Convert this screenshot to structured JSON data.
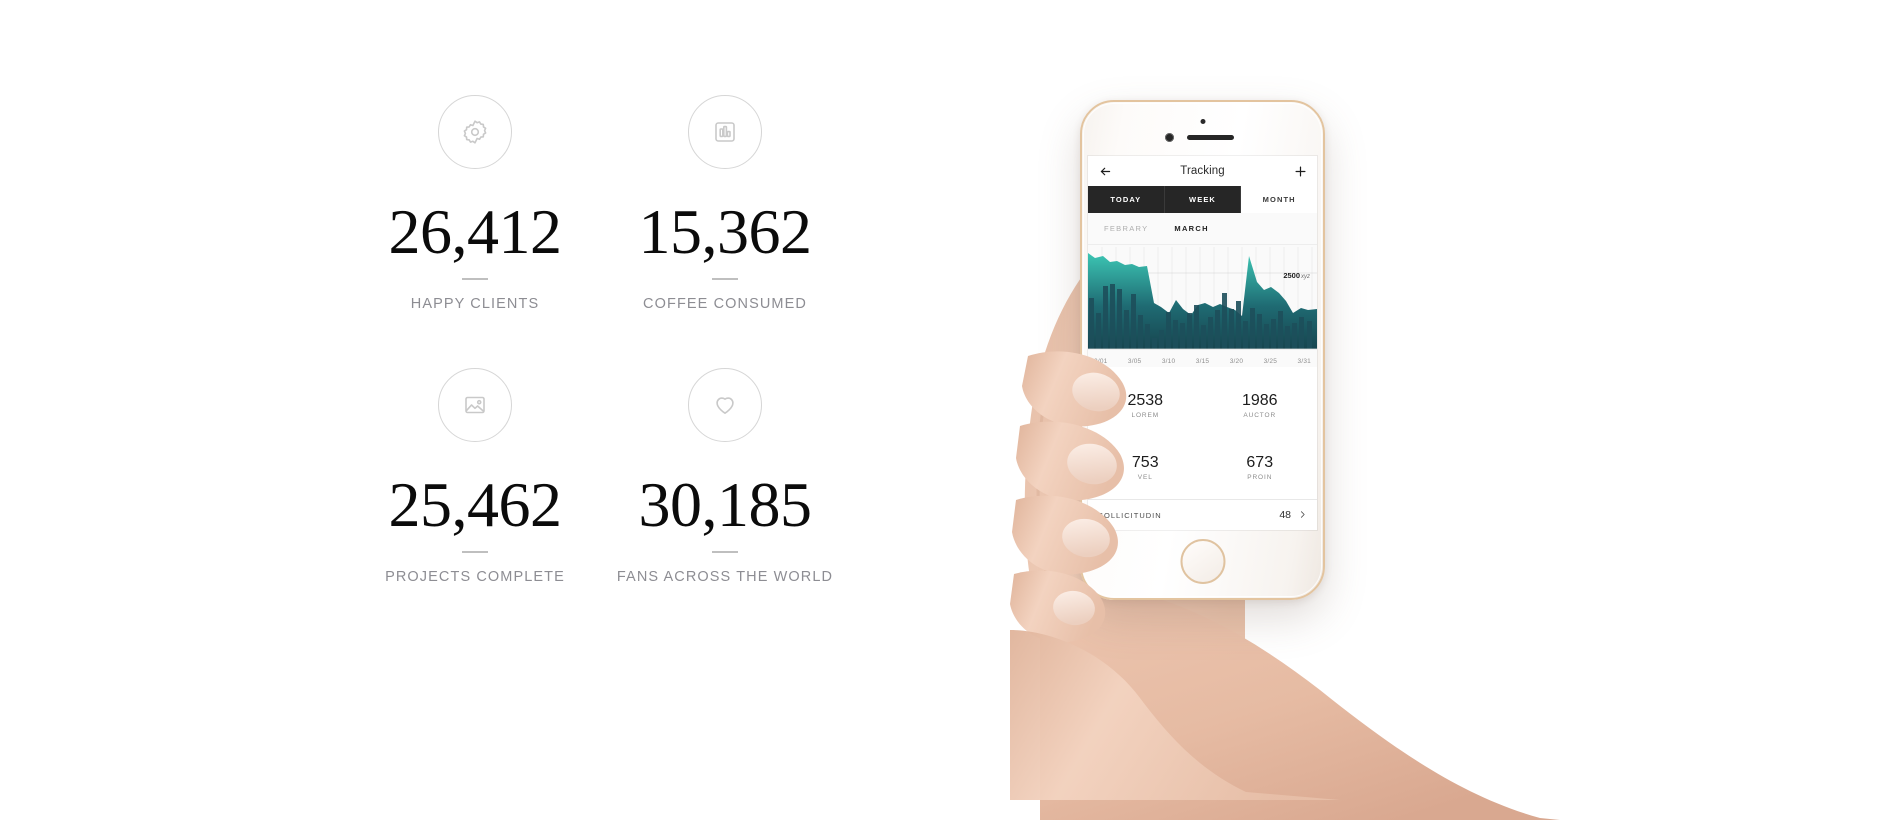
{
  "stats": [
    {
      "icon": "gear-icon",
      "value": "26,412",
      "label": "HAPPY CLIENTS"
    },
    {
      "icon": "chart-icon",
      "value": "15,362",
      "label": "COFFEE CONSUMED"
    },
    {
      "icon": "image-icon",
      "value": "25,462",
      "label": "PROJECTS COMPLETE"
    },
    {
      "icon": "heart-icon",
      "value": "30,185",
      "label": "FANS ACROSS THE WORLD"
    }
  ],
  "phone": {
    "app_bar": {
      "back_icon": "arrow-left-icon",
      "title": "Tracking",
      "add_icon": "plus-icon"
    },
    "tabs": [
      {
        "label": "TODAY",
        "active": false
      },
      {
        "label": "WEEK",
        "active": false
      },
      {
        "label": "MONTH",
        "active": true
      }
    ],
    "months": [
      {
        "label": "FEBRARY",
        "active": false
      },
      {
        "label": "MARCH",
        "active": true
      }
    ],
    "chart_annotation": {
      "value": "2500",
      "unit": "xyz"
    },
    "kpis": [
      {
        "value": "2538",
        "label": "LOREM"
      },
      {
        "value": "1986",
        "label": "AUCTOR"
      },
      {
        "value": "753",
        "label": "VEL"
      },
      {
        "value": "673",
        "label": "PROIN"
      }
    ],
    "list_row": {
      "label": "SOLLICITUDIN",
      "value": "48",
      "chevron_icon": "chevron-right-icon"
    }
  },
  "colors": {
    "chart_teal_top": "#3cc6b4",
    "chart_teal_bottom": "#17454f",
    "bar_dark": "#1d4f5b",
    "tab_dark": "#262626",
    "label_gray": "#8d8d93",
    "phone_gold": "#e3c49f"
  },
  "chart_data": {
    "type": "area",
    "title": "",
    "xlabel": "",
    "ylabel": "",
    "ylim": [
      0,
      3400
    ],
    "grid": true,
    "legend": "none",
    "annotations": [
      {
        "text": "2500 xyz",
        "y": 2500
      }
    ],
    "tick_labels": [
      "3/01",
      "3/05",
      "3/10",
      "3/15",
      "3/20",
      "3/25",
      "3/31"
    ],
    "x": [
      "3/01",
      "3/02",
      "3/03",
      "3/04",
      "3/05",
      "3/06",
      "3/07",
      "3/08",
      "3/09",
      "3/10",
      "3/11",
      "3/12",
      "3/13",
      "3/14",
      "3/15",
      "3/16",
      "3/17",
      "3/18",
      "3/19",
      "3/20",
      "3/21",
      "3/22",
      "3/23",
      "3/24",
      "3/25",
      "3/26",
      "3/27",
      "3/28",
      "3/29",
      "3/30",
      "3/31"
    ],
    "series": [
      {
        "name": "area",
        "type": "area",
        "values": [
          3280,
          3150,
          3190,
          3050,
          3080,
          2980,
          3010,
          2940,
          2960,
          1820,
          1700,
          1560,
          1900,
          1660,
          1520,
          1760,
          1820,
          1700,
          1790,
          1720,
          1640,
          1480,
          3200,
          2480,
          2260,
          2340,
          2180,
          1980,
          1560,
          1680,
          1620
        ]
      },
      {
        "name": "bars",
        "type": "bar",
        "values": [
          1980,
          1460,
          2360,
          2420,
          2280,
          1600,
          2100,
          1420,
          1140,
          620,
          900,
          1500,
          1260,
          1180,
          1460,
          1700,
          1120,
          1380,
          1580,
          2120,
          1620,
          1840,
          1240,
          1660,
          1480,
          1220,
          1360,
          1560,
          1180,
          1240,
          1400
        ]
      }
    ]
  }
}
